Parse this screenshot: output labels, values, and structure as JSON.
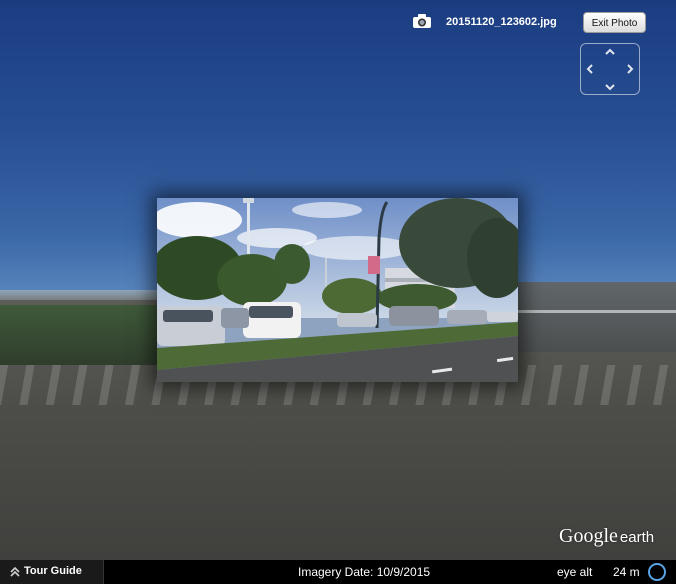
{
  "photo": {
    "filename": "20151120_123602.jpg",
    "exit_label": "Exit Photo"
  },
  "navigation": {
    "icons": [
      "chevron-up-icon",
      "chevron-down-icon",
      "chevron-left-icon",
      "chevron-right-icon"
    ]
  },
  "branding": {
    "google": "Google",
    "earth": "earth"
  },
  "status_bar": {
    "tour_guide_label": "Tour Guide",
    "imagery_date": "Imagery Date: 10/9/2015",
    "eye_alt_label": "eye alt",
    "eye_alt_value": "24 m"
  },
  "colors": {
    "sky": "#284f93",
    "status_bar": "#000000",
    "accent_circle": "#5aa3e6"
  }
}
